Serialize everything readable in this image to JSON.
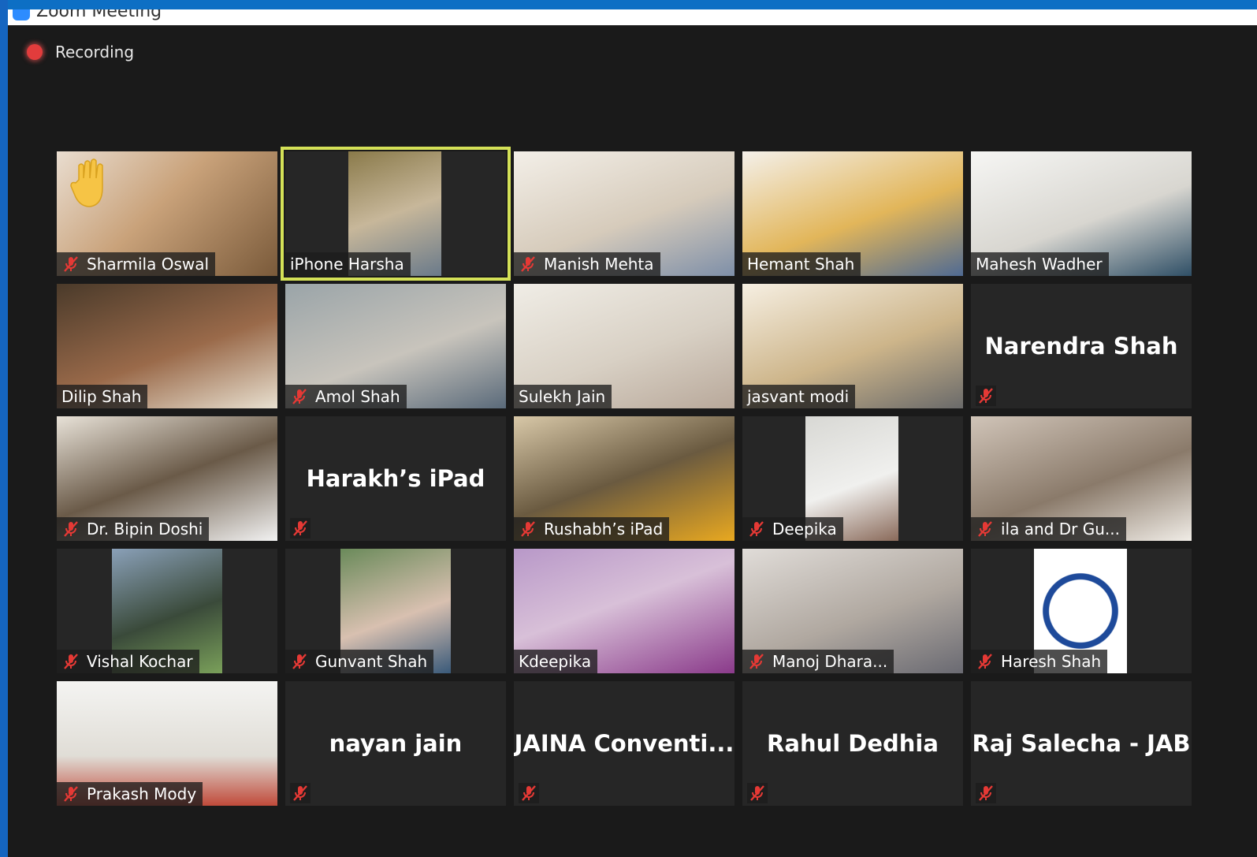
{
  "window": {
    "title": "Zoom Meeting"
  },
  "status": {
    "recording_label": "Recording"
  },
  "colors": {
    "accent": "#2d8cff",
    "active_speaker": "#d4e157",
    "muted_icon": "#e53935",
    "recording": "#e23c3c"
  },
  "participants": [
    {
      "name": "Sharmila Oswal",
      "muted": true,
      "video": true,
      "raised_hand": true
    },
    {
      "name": "iPhone Harsha",
      "muted": false,
      "video": true,
      "active_speaker": true
    },
    {
      "name": "Manish Mehta",
      "muted": true,
      "video": true
    },
    {
      "name": "Hemant Shah",
      "muted": false,
      "video": true
    },
    {
      "name": "Mahesh Wadher",
      "muted": false,
      "video": true
    },
    {
      "name": "Dilip Shah",
      "muted": false,
      "video": true
    },
    {
      "name": "Amol Shah",
      "muted": true,
      "video": true
    },
    {
      "name": "Sulekh Jain",
      "muted": false,
      "video": true
    },
    {
      "name": "jasvant modi",
      "muted": false,
      "video": true
    },
    {
      "name": "Narendra Shah",
      "muted": true,
      "video": false
    },
    {
      "name": "Dr. Bipin Doshi",
      "muted": true,
      "video": true
    },
    {
      "name": "Harakh’s iPad",
      "muted": true,
      "video": false
    },
    {
      "name": "Rushabh’s iPad",
      "muted": true,
      "video": true
    },
    {
      "name": "Deepika",
      "muted": true,
      "video": true
    },
    {
      "name": "ila and Dr Gu...",
      "muted": true,
      "video": true
    },
    {
      "name": "Vishal Kochar",
      "muted": true,
      "video": true
    },
    {
      "name": "Gunvant Shah",
      "muted": true,
      "video": true
    },
    {
      "name": "Kdeepika",
      "muted": false,
      "video": true
    },
    {
      "name": "Manoj Dhara...",
      "muted": true,
      "video": true
    },
    {
      "name": "Haresh Shah",
      "muted": true,
      "video": true
    },
    {
      "name": "Prakash Mody",
      "muted": true,
      "video": true
    },
    {
      "name": "nayan jain",
      "muted": true,
      "video": false
    },
    {
      "name": "JAINA  Conventi...",
      "muted": true,
      "video": false
    },
    {
      "name": "Rahul Dedhia",
      "muted": true,
      "video": false
    },
    {
      "name": "Raj Salecha - JAB",
      "muted": true,
      "video": false
    }
  ]
}
